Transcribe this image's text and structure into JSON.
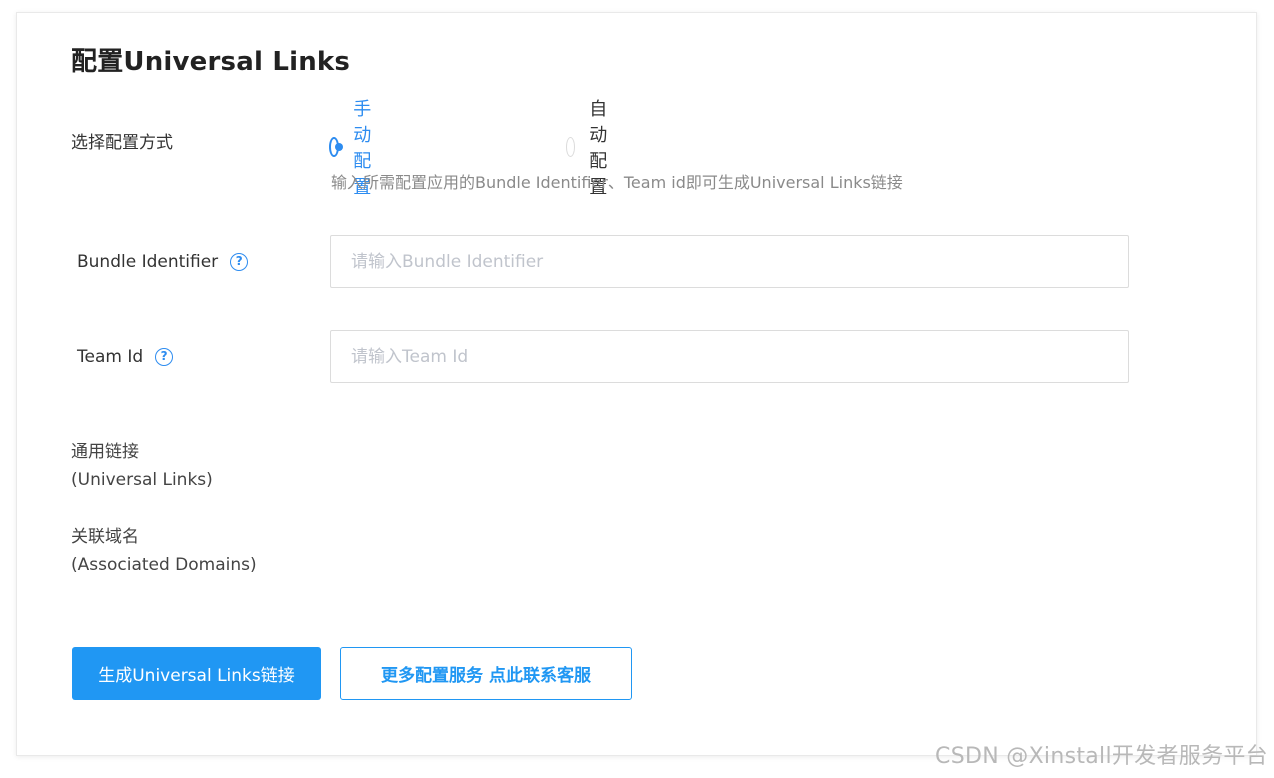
{
  "page": {
    "title": "配置Universal Links"
  },
  "config_method": {
    "label": "选择配置方式",
    "options": [
      {
        "label": "手动配置",
        "selected": true
      },
      {
        "label": "自动配置",
        "selected": false
      }
    ],
    "hint": "输入所需配置应用的Bundle Identifier、Team id即可生成Universal Links链接"
  },
  "fields": {
    "bundle_identifier": {
      "label": "Bundle Identifier",
      "placeholder": "请输入Bundle Identifier",
      "help_icon": "question-circle-icon",
      "help_glyph": "?"
    },
    "team_id": {
      "label": "Team Id",
      "placeholder": "请输入Team Id",
      "help_icon": "question-circle-icon",
      "help_glyph": "?"
    }
  },
  "results": {
    "universal_links": {
      "label_line1": "通用链接",
      "label_line2": "(Universal Links)"
    },
    "associated_domains": {
      "label_line1": "关联域名",
      "label_line2": "(Associated Domains)"
    }
  },
  "actions": {
    "generate_label": "生成Universal Links链接",
    "contact_label": "更多配置服务 点此联系客服"
  },
  "watermark": "CSDN @Xinstall开发者服务平台",
  "colors": {
    "accent": "#2d8cf0",
    "primary_button": "#2097f3",
    "hint_text": "#8a8a8a",
    "border": "#dcdcdc"
  }
}
